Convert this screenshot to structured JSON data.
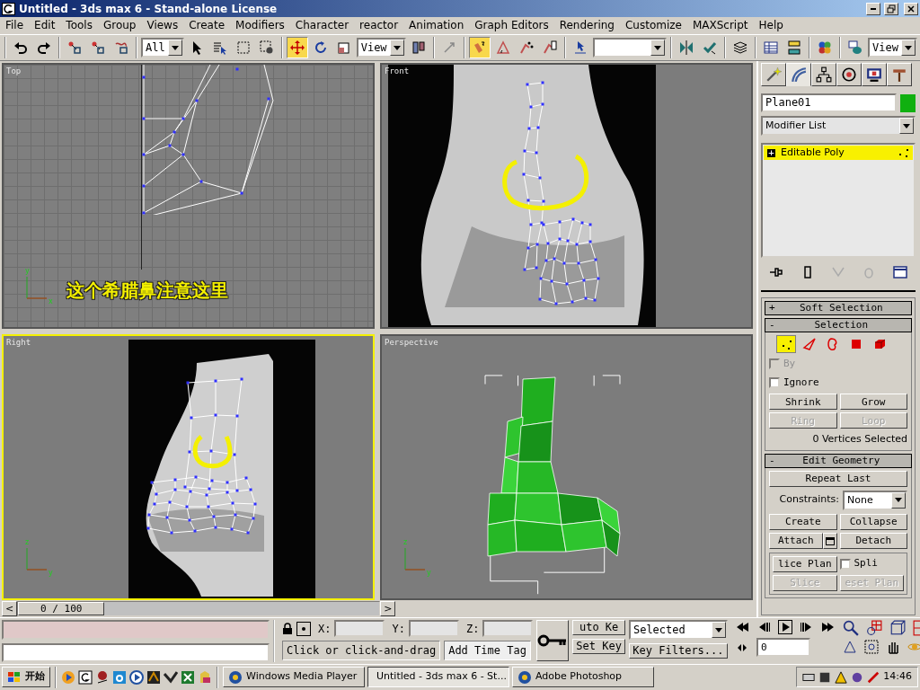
{
  "window": {
    "title": "Untitled - 3ds max 6 - Stand-alone License"
  },
  "menu": [
    "File",
    "Edit",
    "Tools",
    "Group",
    "Views",
    "Create",
    "Modifiers",
    "Character",
    "reactor",
    "Animation",
    "Graph Editors",
    "Rendering",
    "Customize",
    "MAXScript",
    "Help"
  ],
  "toolbar": [
    {
      "kind": "icon",
      "selected": false
    },
    {
      "kind": "icon",
      "selected": false
    },
    {
      "kind": "sep"
    },
    {
      "kind": "icon",
      "selected": false
    },
    {
      "kind": "icon",
      "selected": false
    },
    {
      "kind": "icon",
      "selected": false
    },
    {
      "kind": "sep"
    },
    {
      "kind": "dropdown",
      "value": "All"
    },
    {
      "kind": "icon",
      "selected": false
    },
    {
      "kind": "icon",
      "selected": false
    },
    {
      "kind": "icon",
      "selected": false
    },
    {
      "kind": "icon",
      "selected": false
    },
    {
      "kind": "sep"
    },
    {
      "kind": "icon",
      "selected": true
    },
    {
      "kind": "icon",
      "selected": false
    },
    {
      "kind": "icon",
      "selected": false
    },
    {
      "kind": "dropdown",
      "value": "View"
    },
    {
      "kind": "icon",
      "selected": false
    },
    {
      "kind": "sep"
    },
    {
      "kind": "icon",
      "selected": false
    },
    {
      "kind": "sep"
    },
    {
      "kind": "icon",
      "selected": true
    },
    {
      "kind": "icon",
      "selected": false
    },
    {
      "kind": "icon",
      "selected": false
    },
    {
      "kind": "icon",
      "selected": false
    },
    {
      "kind": "sep"
    },
    {
      "kind": "icon",
      "selected": false
    },
    {
      "kind": "dropdown"
    },
    {
      "kind": "sep"
    },
    {
      "kind": "icon",
      "selected": false
    },
    {
      "kind": "icon",
      "selected": false
    },
    {
      "kind": "sep"
    },
    {
      "kind": "icon",
      "selected": false
    },
    {
      "kind": "sep"
    },
    {
      "kind": "icon",
      "selected": false
    },
    {
      "kind": "icon",
      "selected": false
    },
    {
      "kind": "sep"
    },
    {
      "kind": "icon",
      "selected": false
    },
    {
      "kind": "sep"
    },
    {
      "kind": "icon",
      "selected": false
    },
    {
      "kind": "dropdown",
      "value": "View"
    }
  ],
  "viewports": [
    {
      "label": "Top",
      "active": false,
      "kind": "grid",
      "axes": [
        "y",
        "x"
      ],
      "annotation": "这个希腊鼻注意这里"
    },
    {
      "label": "Front",
      "active": false,
      "kind": "front"
    },
    {
      "label": "Right",
      "active": true,
      "kind": "right",
      "axes": [
        "z",
        "y"
      ]
    },
    {
      "label": "Perspective",
      "active": false,
      "kind": "mesh",
      "axes": [
        "z",
        "y"
      ]
    }
  ],
  "time_slider": {
    "prev": "<",
    "position": "0 / 100",
    "next": ">",
    "level": 0
  },
  "command_panel": {
    "tabs": [
      {
        "selected": false
      },
      {
        "selected": true
      },
      {
        "selected": false
      },
      {
        "selected": false
      },
      {
        "selected": false
      },
      {
        "selected": false
      }
    ],
    "object_name": "Plane01",
    "modifier_list": "Modifier List",
    "stack": [
      {
        "sign": "+",
        "label": "Editable Poly",
        "selected": true
      }
    ],
    "rollouts": [
      {
        "sign": "+",
        "title": "Soft Selection"
      },
      {
        "sign": "-",
        "title": "Selection",
        "subobjects": [
          {
            "selected": true
          },
          {
            "selected": false
          },
          {
            "selected": false
          },
          {
            "selected": false
          },
          {
            "selected": false
          }
        ],
        "checks": [
          {
            "label": "By",
            "checked": false,
            "disabled": true
          },
          {
            "label": "Ignore",
            "checked": false,
            "disabled": false
          }
        ],
        "buttons": [
          {
            "label": "Shrink",
            "disabled": false
          },
          {
            "label": "Grow",
            "disabled": false
          },
          {
            "label": "Ring",
            "disabled": true
          },
          {
            "label": "Loop",
            "disabled": true
          }
        ],
        "info": "0 Vertices Selected"
      },
      {
        "sign": "-",
        "title": "Edit Geometry",
        "repeat": "Repeat Last",
        "constraints_label": "Constraints:",
        "constraints_value": "None",
        "buttons": [
          {
            "kind": "plain",
            "label": "Create",
            "disabled": false
          },
          {
            "kind": "plain",
            "label": "Collapse",
            "disabled": false
          },
          {
            "kind": "settings",
            "label": "Attach",
            "disabled": false
          },
          {
            "kind": "plain",
            "label": "Detach",
            "disabled": false
          }
        ],
        "slice_plane": "lice Plan",
        "split": {
          "label": "Spli",
          "checked": false
        },
        "slice_buttons": [
          {
            "label": "Slice",
            "disabled": true
          },
          {
            "label": "eset Plan",
            "disabled": true
          }
        ]
      }
    ]
  },
  "status": {
    "prompt": "Click or click-and-drag",
    "time_tag": "Add Time Tag",
    "x_label": "X:",
    "y_label": "Y:",
    "z_label": "Z:",
    "auto_key": "uto Ke",
    "set_key": "Set Key",
    "key_mode": "Selected",
    "key_filters": "Key Filters...",
    "frame": "0"
  },
  "taskbar": {
    "start": "开始",
    "tasks": [
      {
        "label": "Windows Media Player",
        "selected": false
      },
      {
        "label": "Untitled - 3ds max 6 - St...",
        "selected": true
      },
      {
        "label": "Adobe Photoshop",
        "selected": false
      }
    ],
    "clock": "14:46"
  }
}
